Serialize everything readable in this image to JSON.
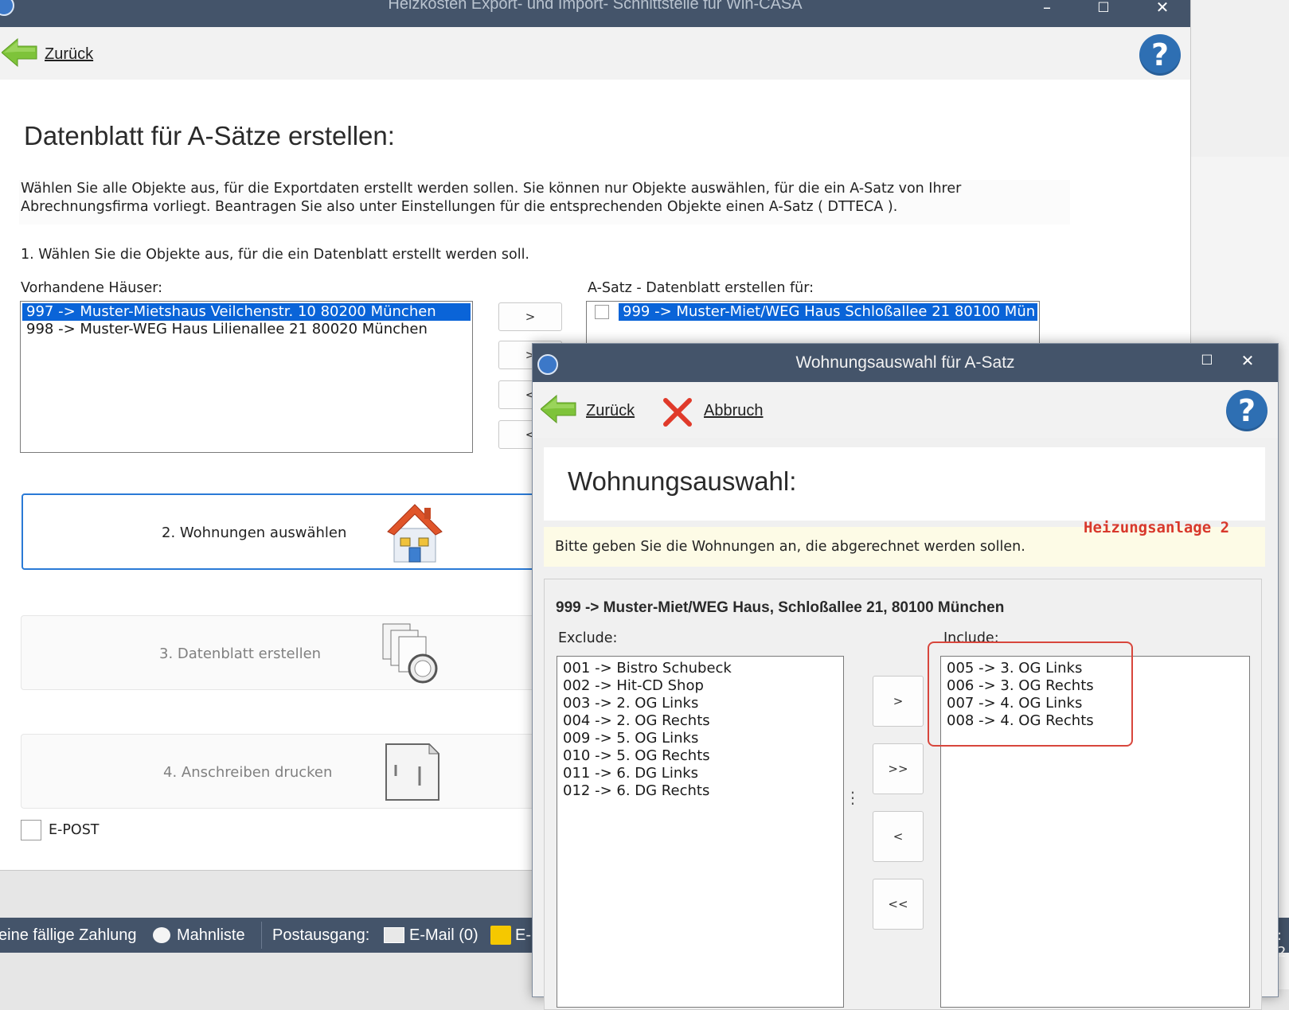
{
  "main_window": {
    "title": "Heizkosten Export- und Import- Schnittstelle für Win-CASA",
    "controls": {
      "minimize": "–",
      "maximize": "☐",
      "close": "✕"
    },
    "toolbar": {
      "back_label": "Zurück",
      "help": "?"
    },
    "heading": "Datenblatt für A-Sätze erstellen:",
    "description_line1": "Wählen Sie alle Objekte aus, für die Exportdaten erstellt werden sollen. Sie können nur Objekte auswählen, für die ein A-Satz von Ihrer",
    "description_line2": "Abrechnungsfirma vorliegt. Beantragen Sie also unter Einstellungen für die entsprechenden Objekte einen A-Satz ( DTTECA ).",
    "step1_label": "1. Wählen Sie die Objekte aus, für die ein Datenblatt erstellt werden soll.",
    "available_houses_label": "Vorhandene Häuser:",
    "available_houses": [
      "997 -> Muster-Mietshaus  Veilchenstr. 10   80200 München",
      "998 -> Muster-WEG Haus  Lilienallee 21   80020 München"
    ],
    "transfer_buttons": [
      ">",
      ">",
      "<",
      "<"
    ],
    "selected_label": "A-Satz - Datenblatt erstellen für:",
    "selected_houses": [
      "999 -> Muster-Miet/WEG Haus  Schloßallee 21   80100 Mün"
    ],
    "steps": [
      {
        "label": "2. Wohnungen auswählen",
        "icon": "house-icon"
      },
      {
        "label": "3. Datenblatt erstellen",
        "icon": "documents-icon"
      },
      {
        "label": "4. Anschreiben drucken",
        "icon": "letter-icon"
      }
    ],
    "epost_label": "E-POST"
  },
  "statusbar": {
    "due_payment": "eine fällige Zahlung",
    "dunning": "Mahnliste",
    "outbox_label": "Postausgang:",
    "email": "E-Mail (0)",
    "post_partial": "E-",
    "right_fragment": ": 2"
  },
  "dialog": {
    "title": "Wohnungsauswahl für A-Satz",
    "controls": {
      "maximize": "☐",
      "close": "✕"
    },
    "back_label": "Zurück",
    "cancel_label": "Abbruch",
    "help": "?",
    "heading": "Wohnungsauswahl:",
    "annotation": "Heizungsanlage 2",
    "hint": "Bitte geben Sie die Wohnungen an, die abgerechnet werden sollen.",
    "group_title": "999 -> Muster-Miet/WEG Haus, Schloßallee 21, 80100 München",
    "exclude_label": "Exclude:",
    "include_label": "Include:",
    "exclude_items": [
      "001 -> Bistro Schubeck",
      "002 -> Hit-CD Shop",
      "003 -> 2. OG Links",
      "004 -> 2. OG Rechts",
      "009 -> 5. OG Links",
      "010 -> 5. OG Rechts",
      "011 -> 6. DG Links",
      "012 -> 6. DG Rechts"
    ],
    "include_items": [
      "005 -> 3. OG Links",
      "006 -> 3. OG Rechts",
      "007 -> 4. OG Links",
      "008 -> 4. OG Rechts"
    ],
    "move_buttons": [
      ">",
      ">>",
      "<",
      "<<"
    ],
    "splitter": "⋮"
  },
  "colors": {
    "titlebar": "#44546a",
    "selection": "#0a64d8",
    "accent_blue": "#2a7ad6",
    "annotation_red": "#d8463c"
  }
}
